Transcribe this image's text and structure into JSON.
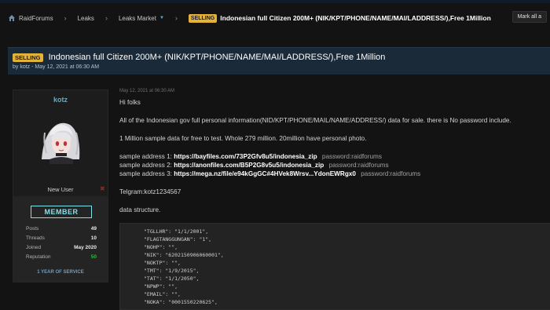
{
  "breadcrumb": {
    "items": [
      "RaidForums",
      "Leaks",
      "Leaks Market"
    ],
    "badge": "SELLING",
    "title": "Indonesian full Citizen 200M+ (NIK/KPT/PHONE/NAME/MAI/LADDRESS/),Free 1Million"
  },
  "header": {
    "mark_button": "Mark all a",
    "badge": "SELLING",
    "title": "Indonesian full Citizen 200M+ (NIK/KPT/PHONE/NAME/MAI/LADDRESS/),Free 1Million",
    "meta": "by kotz - May 12, 2021 at 06:30 AM"
  },
  "user": {
    "name": "kotz",
    "title": "New User",
    "rank": "MEMBER",
    "stats": [
      {
        "label": "Posts",
        "value": "49"
      },
      {
        "label": "Threads",
        "value": "10"
      },
      {
        "label": "Joined",
        "value": "May 2020"
      },
      {
        "label": "Reputation",
        "value": "50"
      }
    ],
    "service": "1 YEAR OF SERVICE",
    "colors": {
      "username": "#4fb2d6",
      "rank": "#7fe2e8",
      "reputation": "#3fb04a"
    }
  },
  "post": {
    "date": "May 12, 2021 at 06:30 AM",
    "greeting": "Hi folks",
    "intro": "All of the Indonesian gov full personal information(NID/KPT/PHONE/MAIL/NAME/ADDRESS/) data for sale. there is No password include.",
    "sample_info": "1 Million sample data for free to test. Whole 279 million. 20million have personal photo.",
    "samples": [
      {
        "label": "sample address 1:",
        "url": "https://bayfiles.com/73P2Gfv8u5/indonesia_zip",
        "password": "password:raidforums"
      },
      {
        "label": "sample address 2:",
        "url": "https://anonfiles.com/B5P2G8v5u5/indonesia_zip",
        "password": "password:raidforums"
      },
      {
        "label": "sample address 3:",
        "url": "https://mega.nz/file/e94kGgGC#4HVek8Wrsv...YdonEWRgx0",
        "password": "password:raidforums"
      }
    ],
    "telegram": "Telgram:kotz1234567",
    "structure_label": "data structure.",
    "code_lines": [
      "\"TGLLHR\": \"1/1/2001\",",
      "\"FLAGTANGGUNGAN\": \"1\",",
      "\"NOHP\": \"\",",
      "\"NIK\": \"6202150906060001\",",
      "\"NOKTP\": \"\",",
      "\"TMT\": \"1/9/2015\",",
      "\"TAT\": \"1/1/2050\",",
      "\"NPWP\": \"\",",
      "\"EMAIL\": \"\",",
      "\"NOKA\": \"0001550220625\","
    ]
  },
  "colors": {
    "badge": "#e3b23a",
    "header_bg": "#1b2a38",
    "page_bg": "#131313"
  }
}
